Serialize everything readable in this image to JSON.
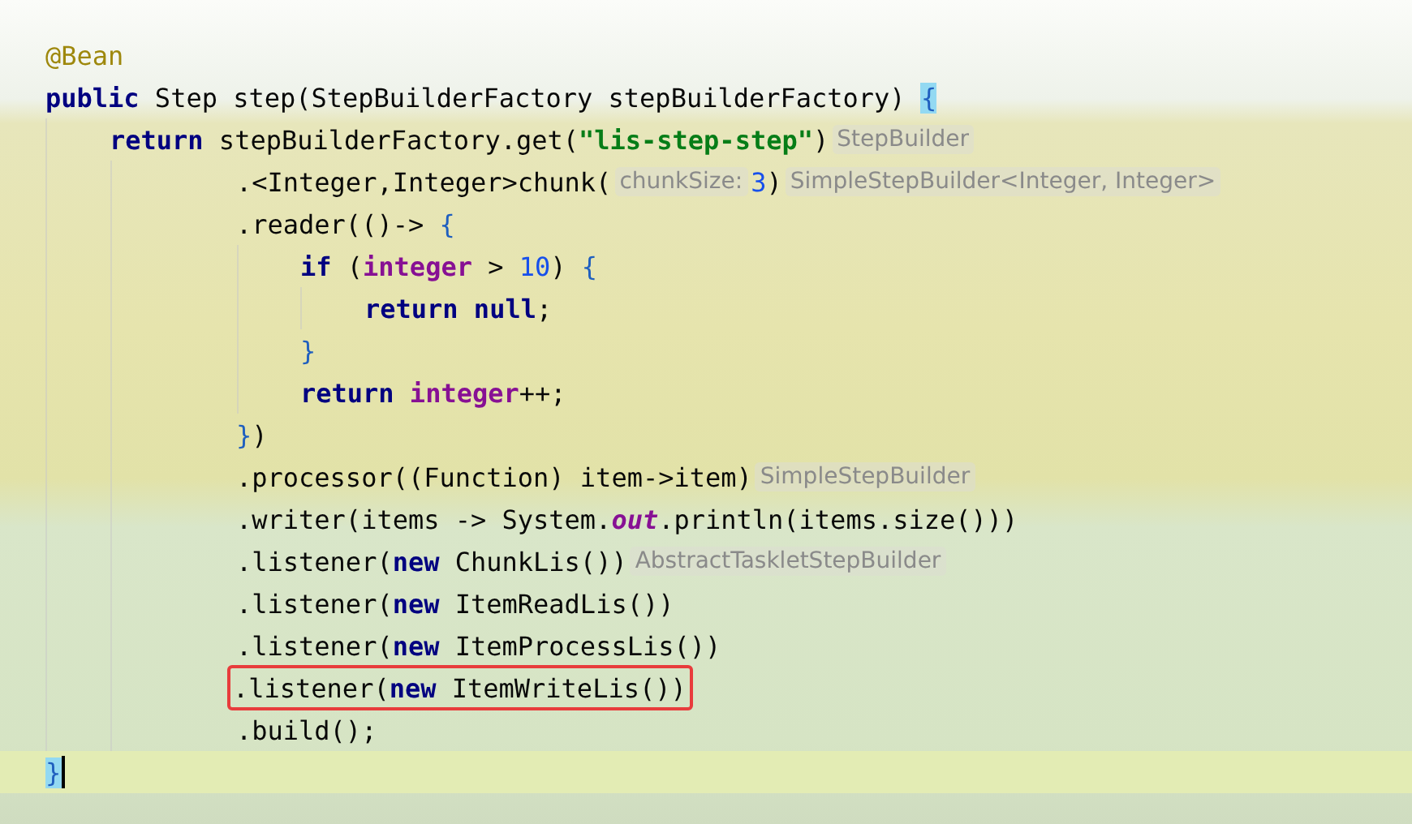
{
  "editor": {
    "lines": [
      {
        "segments": [
          {
            "kind": "code",
            "tokens": [
              {
                "kind": "annotation",
                "text": "@Bean"
              }
            ]
          }
        ]
      },
      {
        "segments": [
          {
            "kind": "code",
            "tokens": [
              {
                "kind": "keyword",
                "text": "public"
              },
              {
                "kind": "plain",
                "text": " Step step(StepBuilderFactory stepBuilderFactory) "
              },
              {
                "kind": "bracematch",
                "text": "{"
              }
            ]
          }
        ],
        "children": [
          {
            "continuation": true,
            "segments": [
              {
                "kind": "code",
                "tokens": [
                  {
                    "kind": "keyword",
                    "text": "return"
                  },
                  {
                    "kind": "plain",
                    "text": " stepBuilderFactory.get("
                  },
                  {
                    "kind": "string",
                    "text": "\"lis-step-step\""
                  },
                  {
                    "kind": "plain",
                    "text": ")"
                  }
                ]
              },
              {
                "kind": "hint",
                "text": "StepBuilder"
              }
            ],
            "children": [
              {
                "segments": [
                  {
                    "kind": "code",
                    "tokens": [
                      {
                        "kind": "plain",
                        "text": ".<Integer,Integer>chunk("
                      }
                    ]
                  },
                  {
                    "kind": "hint",
                    "text": "chunkSize:"
                  },
                  {
                    "kind": "code",
                    "tokens": [
                      {
                        "kind": "number",
                        "text": "3"
                      },
                      {
                        "kind": "plain",
                        "text": ")"
                      }
                    ]
                  },
                  {
                    "kind": "hint",
                    "text": "SimpleStepBuilder<Integer, Integer>"
                  }
                ]
              },
              {
                "segments": [
                  {
                    "kind": "code",
                    "tokens": [
                      {
                        "kind": "plain",
                        "text": ".reader(()-> "
                      },
                      {
                        "kind": "brace",
                        "text": "{"
                      }
                    ]
                  }
                ],
                "children": [
                  {
                    "segments": [
                      {
                        "kind": "code",
                        "tokens": [
                          {
                            "kind": "keyword",
                            "text": "if"
                          },
                          {
                            "kind": "plain",
                            "text": " ("
                          },
                          {
                            "kind": "variable",
                            "text": "integer"
                          },
                          {
                            "kind": "plain",
                            "text": " > "
                          },
                          {
                            "kind": "number",
                            "text": "10"
                          },
                          {
                            "kind": "plain",
                            "text": ") "
                          },
                          {
                            "kind": "brace",
                            "text": "{"
                          }
                        ]
                      }
                    ],
                    "children": [
                      {
                        "segments": [
                          {
                            "kind": "code",
                            "tokens": [
                              {
                                "kind": "keyword",
                                "text": "return null"
                              },
                              {
                                "kind": "plain",
                                "text": ";"
                              }
                            ]
                          }
                        ]
                      }
                    ]
                  },
                  {
                    "segments": [
                      {
                        "kind": "code",
                        "tokens": [
                          {
                            "kind": "brace",
                            "text": "}"
                          }
                        ]
                      }
                    ]
                  },
                  {
                    "segments": [
                      {
                        "kind": "code",
                        "tokens": [
                          {
                            "kind": "keyword",
                            "text": "return"
                          },
                          {
                            "kind": "variable",
                            "text": " integer"
                          },
                          {
                            "kind": "plain",
                            "text": "++;"
                          }
                        ]
                      }
                    ]
                  }
                ]
              },
              {
                "segments": [
                  {
                    "kind": "code",
                    "tokens": [
                      {
                        "kind": "brace",
                        "text": "}"
                      },
                      {
                        "kind": "plain",
                        "text": ")"
                      }
                    ]
                  }
                ]
              },
              {
                "segments": [
                  {
                    "kind": "code",
                    "tokens": [
                      {
                        "kind": "plain",
                        "text": ".processor((Function) item->item)"
                      }
                    ]
                  },
                  {
                    "kind": "hint",
                    "text": "SimpleStepBuilder"
                  }
                ]
              },
              {
                "segments": [
                  {
                    "kind": "code",
                    "tokens": [
                      {
                        "kind": "plain",
                        "text": ".writer(items -> System."
                      },
                      {
                        "kind": "static",
                        "text": "out"
                      },
                      {
                        "kind": "plain",
                        "text": ".println(items.size()))"
                      }
                    ]
                  }
                ]
              },
              {
                "segments": [
                  {
                    "kind": "code",
                    "tokens": [
                      {
                        "kind": "plain",
                        "text": ".listener("
                      },
                      {
                        "kind": "keyword",
                        "text": "new"
                      },
                      {
                        "kind": "plain",
                        "text": " ChunkLis())"
                      }
                    ]
                  },
                  {
                    "kind": "hint",
                    "text": "AbstractTaskletStepBuilder"
                  }
                ]
              },
              {
                "segments": [
                  {
                    "kind": "code",
                    "tokens": [
                      {
                        "kind": "plain",
                        "text": ".listener("
                      },
                      {
                        "kind": "keyword",
                        "text": "new"
                      },
                      {
                        "kind": "plain",
                        "text": " ItemReadLis())"
                      }
                    ]
                  }
                ]
              },
              {
                "segments": [
                  {
                    "kind": "code",
                    "tokens": [
                      {
                        "kind": "plain",
                        "text": ".listener("
                      },
                      {
                        "kind": "keyword",
                        "text": "new"
                      },
                      {
                        "kind": "plain",
                        "text": " ItemProcessLis())"
                      }
                    ]
                  }
                ]
              },
              {
                "boxed": true,
                "segments": [
                  {
                    "kind": "code",
                    "tokens": [
                      {
                        "kind": "plain",
                        "text": ".listener("
                      },
                      {
                        "kind": "keyword",
                        "text": "new"
                      },
                      {
                        "kind": "plain",
                        "text": " ItemWriteLis())"
                      }
                    ]
                  }
                ]
              },
              {
                "segments": [
                  {
                    "kind": "code",
                    "tokens": [
                      {
                        "kind": "plain",
                        "text": ".build();"
                      }
                    ]
                  }
                ]
              }
            ]
          }
        ]
      },
      {
        "current": true,
        "segments": [
          {
            "kind": "code",
            "tokens": [
              {
                "kind": "bracematch",
                "text": "}"
              }
            ]
          }
        ]
      }
    ]
  }
}
